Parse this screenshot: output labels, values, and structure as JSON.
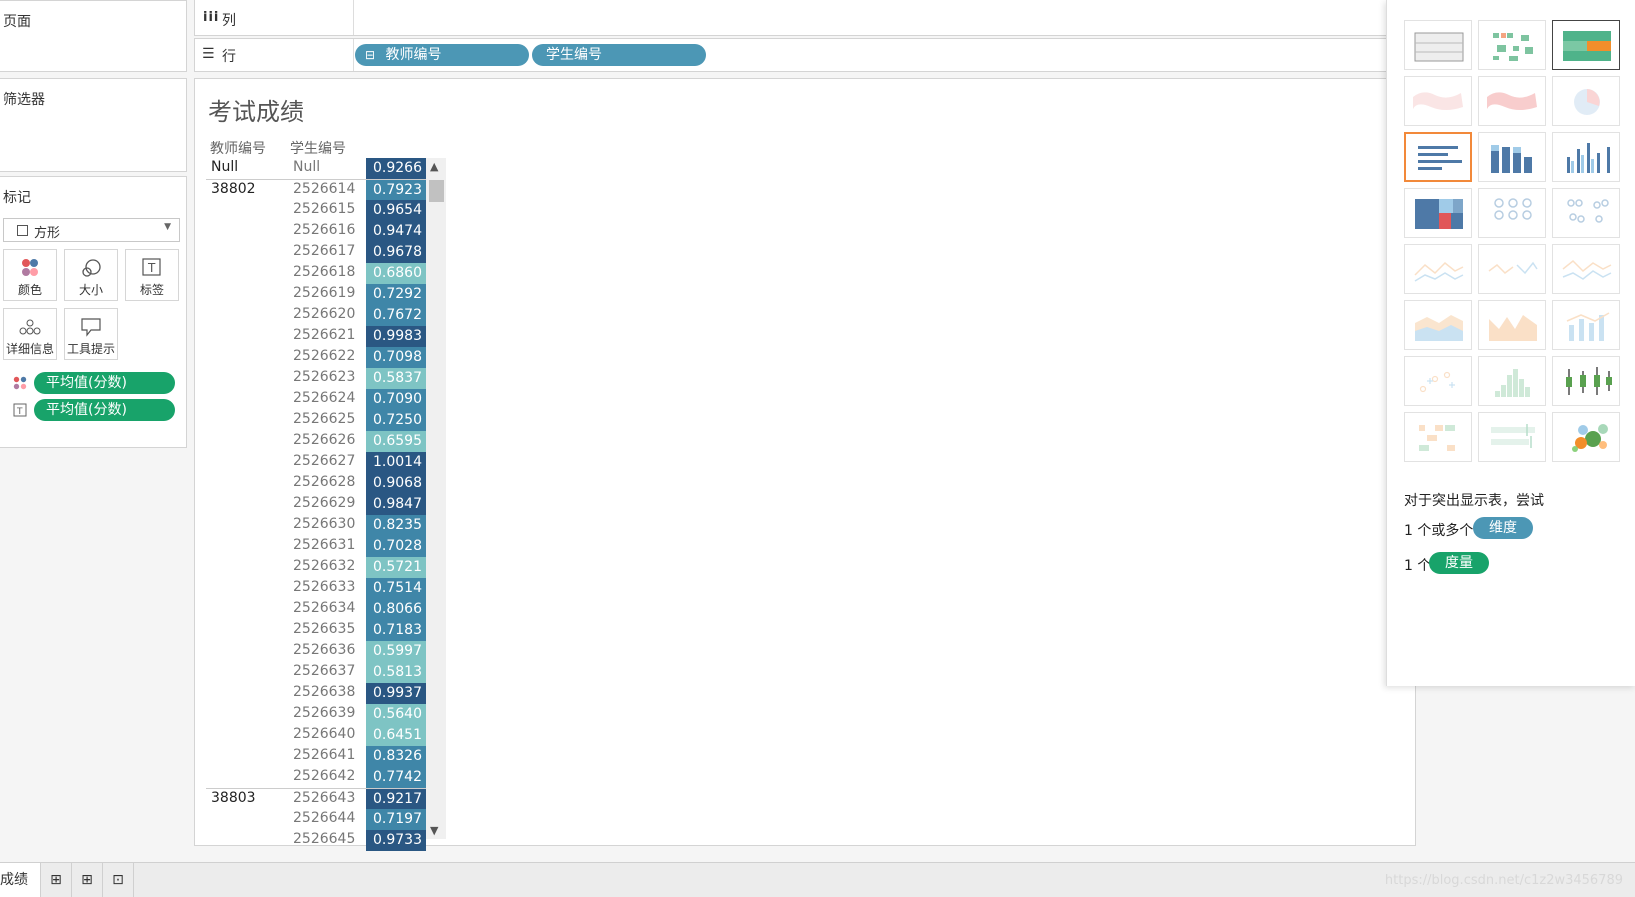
{
  "panels": {
    "pages": "页面",
    "filters": "筛选器",
    "marks": "标记"
  },
  "marks": {
    "type": "方形",
    "buttons": [
      "颜色",
      "大小",
      "标签",
      "详细信息",
      "工具提示"
    ],
    "fields": [
      {
        "icon": "color-dots-icon",
        "label": "平均值(分数)"
      },
      {
        "icon": "text-icon",
        "label": "平均值(分数)"
      }
    ]
  },
  "shelves": {
    "columns_label": "列",
    "rows_label": "行",
    "row_pills": [
      "教师编号",
      "学生编号"
    ]
  },
  "viz": {
    "title": "考试成绩",
    "headers": [
      "教师编号",
      "学生编号"
    ],
    "rows": [
      {
        "t": "Null",
        "s": "Null",
        "v": "0.9266"
      },
      {
        "t": "38802",
        "s": "2526614",
        "v": "0.7923"
      },
      {
        "t": "",
        "s": "2526615",
        "v": "0.9654"
      },
      {
        "t": "",
        "s": "2526616",
        "v": "0.9474"
      },
      {
        "t": "",
        "s": "2526617",
        "v": "0.9678"
      },
      {
        "t": "",
        "s": "2526618",
        "v": "0.6860"
      },
      {
        "t": "",
        "s": "2526619",
        "v": "0.7292"
      },
      {
        "t": "",
        "s": "2526620",
        "v": "0.7672"
      },
      {
        "t": "",
        "s": "2526621",
        "v": "0.9983"
      },
      {
        "t": "",
        "s": "2526622",
        "v": "0.7098"
      },
      {
        "t": "",
        "s": "2526623",
        "v": "0.5837"
      },
      {
        "t": "",
        "s": "2526624",
        "v": "0.7090"
      },
      {
        "t": "",
        "s": "2526625",
        "v": "0.7250"
      },
      {
        "t": "",
        "s": "2526626",
        "v": "0.6595"
      },
      {
        "t": "",
        "s": "2526627",
        "v": "1.0014"
      },
      {
        "t": "",
        "s": "2526628",
        "v": "0.9068"
      },
      {
        "t": "",
        "s": "2526629",
        "v": "0.9847"
      },
      {
        "t": "",
        "s": "2526630",
        "v": "0.8235"
      },
      {
        "t": "",
        "s": "2526631",
        "v": "0.7028"
      },
      {
        "t": "",
        "s": "2526632",
        "v": "0.5721"
      },
      {
        "t": "",
        "s": "2526633",
        "v": "0.7514"
      },
      {
        "t": "",
        "s": "2526634",
        "v": "0.8066"
      },
      {
        "t": "",
        "s": "2526635",
        "v": "0.7183"
      },
      {
        "t": "",
        "s": "2526636",
        "v": "0.5997"
      },
      {
        "t": "",
        "s": "2526637",
        "v": "0.5813"
      },
      {
        "t": "",
        "s": "2526638",
        "v": "0.9937"
      },
      {
        "t": "",
        "s": "2526639",
        "v": "0.5640"
      },
      {
        "t": "",
        "s": "2526640",
        "v": "0.6451"
      },
      {
        "t": "",
        "s": "2526641",
        "v": "0.8326"
      },
      {
        "t": "",
        "s": "2526642",
        "v": "0.7742"
      },
      {
        "t": "38803",
        "s": "2526643",
        "v": "0.9217"
      },
      {
        "t": "",
        "s": "2526644",
        "v": "0.7197"
      },
      {
        "t": "",
        "s": "2526645",
        "v": "0.9733"
      }
    ]
  },
  "showme": {
    "hint": "对于突出显示表，尝试",
    "line1_prefix": "1 个或多个",
    "line1_pill": "维度",
    "line2_prefix": "1 个",
    "line2_pill": "度量"
  },
  "bottom": {
    "sheet_tab": "成绩",
    "watermark": "https://blog.csdn.net/c1z2w3456789"
  },
  "colors": {
    "dark": "#2a5783",
    "mid": "#3f86a8",
    "light": "#7ec4c4",
    "dimension": "#4c97b5",
    "measure": "#18a36a",
    "highlight": "#f2893a"
  }
}
